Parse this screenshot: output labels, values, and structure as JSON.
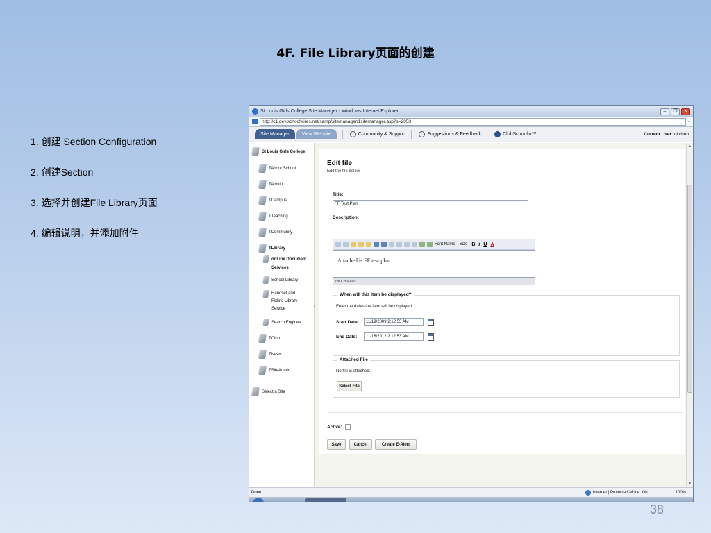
{
  "slide": {
    "title": "4F. File Library页面的创建",
    "steps": [
      "1.  创建 Section Configuration",
      "2.  创建Section",
      "3.  选择并创建File Library页面",
      "4.  编辑说明，并添加附件"
    ],
    "page_number": "38"
  },
  "browser": {
    "window_title": "St Louis Girls College Site Manager - Windows Internet Explorer",
    "url": "http://c1.dev.schoolwires.net/samp/sitemanager/1sitemanager.asp?s=2053",
    "tabs": [
      "Site Manager",
      "View Website"
    ],
    "nav_links": [
      "Community & Support",
      "Suggestions & Feedback",
      "ClubSchoolio™"
    ],
    "current_user_label": "Current User:",
    "current_user": "qi chen",
    "status_left": "Done",
    "status_zone": "Internet | Protected Mode: On",
    "zoom": "100%"
  },
  "sidebar": {
    "root": "St Louis Girls College",
    "items": [
      "TAbout School",
      "TAdmin",
      "TCampus",
      "TTeaching",
      "TCommunity",
      "TLibrary"
    ],
    "library_sub": [
      "onLine Document Services",
      "School Library",
      "Handset and Fixline Library Service",
      "Search Engines"
    ],
    "items_after": [
      "TClub",
      "TNews",
      "TSiteAdmin"
    ],
    "select_site": "Select a Site"
  },
  "form": {
    "heading": "Edit file",
    "subheading": "Edit the file below.",
    "title_label": "Title:",
    "title_value": "FF Test Plan",
    "description_label": "Description:",
    "font_name": "Font Name",
    "font_size": "Size",
    "editor_text": "Attached is FF test plan",
    "path_bar": "<BODY> <P>",
    "display_legend": "When will this item be displayed?",
    "display_hint": "Enter the dates the item will be displayed.",
    "start_label": "Start Date:",
    "start_value": "11/19/2009 2:12:53 AM",
    "end_label": "End Date:",
    "end_value": "11/18/2012 2:12:53 AM",
    "attached_legend": "Attached File",
    "attached_status": "No file is attached.",
    "select_file": "Select File",
    "active_label": "Active:",
    "buttons": {
      "save": "Save",
      "cancel": "Cancel",
      "alert": "Create E-Alert"
    }
  }
}
